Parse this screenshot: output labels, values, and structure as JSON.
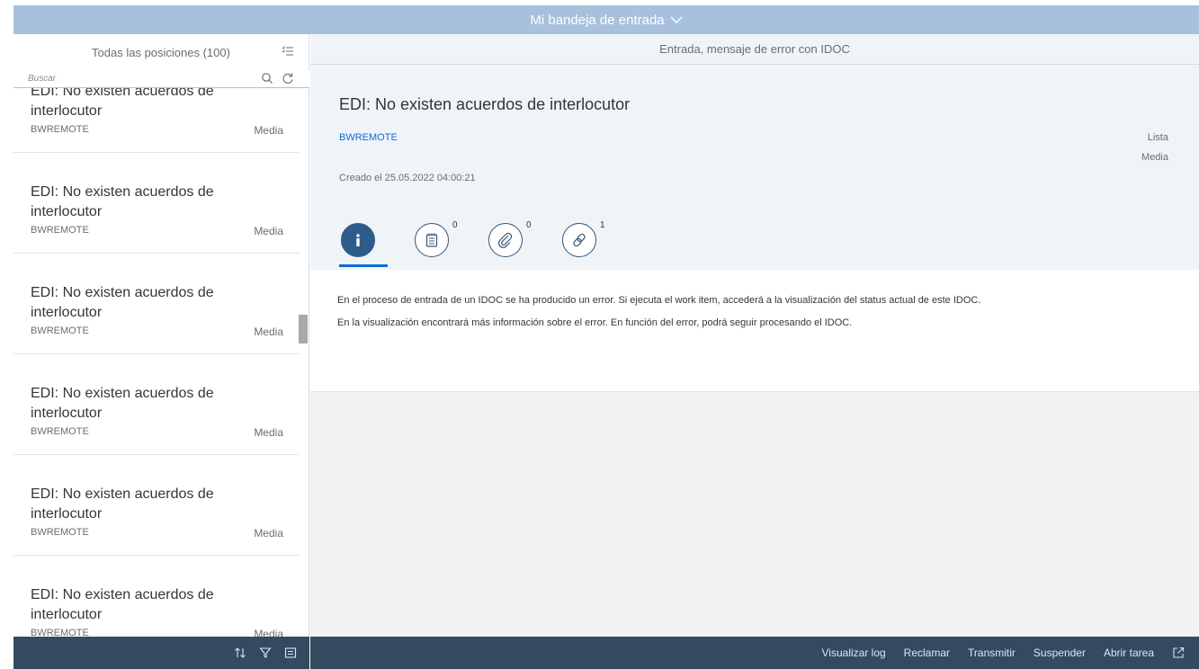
{
  "shell": {
    "title": "Mi bandeja de entrada"
  },
  "master": {
    "header": "Todas las posiciones (100)",
    "search_placeholder": "Buscar",
    "items": [
      {
        "title": "EDI: No existen acuerdos de interlocutor",
        "system": "BWREMOTE",
        "priority": "Media"
      },
      {
        "title": "EDI: No existen acuerdos de interlocutor",
        "system": "BWREMOTE",
        "priority": "Media"
      },
      {
        "title": "EDI: No existen acuerdos de interlocutor",
        "system": "BWREMOTE",
        "priority": "Media"
      },
      {
        "title": "EDI: No existen acuerdos de interlocutor",
        "system": "BWREMOTE",
        "priority": "Media"
      },
      {
        "title": "EDI: No existen acuerdos de interlocutor",
        "system": "BWREMOTE",
        "priority": "Media"
      },
      {
        "title": "EDI: No existen acuerdos de interlocutor",
        "system": "BWREMOTE",
        "priority": "Media"
      }
    ]
  },
  "detail": {
    "header": "Entrada, mensaje de error con IDOC",
    "title": "EDI: No existen acuerdos de interlocutor",
    "system": "BWREMOTE",
    "status": "Lista",
    "priority": "Media",
    "created": "Creado el 25.05.2022 04:00:21",
    "tabs": [
      {
        "icon": "info-icon",
        "count": ""
      },
      {
        "icon": "notes-icon",
        "count": "0"
      },
      {
        "icon": "attachment-icon",
        "count": "0"
      },
      {
        "icon": "link-icon",
        "count": "1"
      }
    ],
    "description": [
      "En el proceso de entrada de un IDOC se ha producido un error. Si ejecuta el work item, accederá a la visualización del status actual de este IDOC.",
      "En la visualización encontrará más información sobre el error. En función del error, podrá seguir procesando el IDOC."
    ]
  },
  "footer": {
    "actions": [
      "Visualizar log",
      "Reclamar",
      "Transmitir",
      "Suspender",
      "Abrir tarea"
    ]
  },
  "colors": {
    "shell": "#a7c1dd",
    "footer": "#354a5f",
    "link": "#0a6ed1",
    "active_tab": "#2e5c8a"
  }
}
